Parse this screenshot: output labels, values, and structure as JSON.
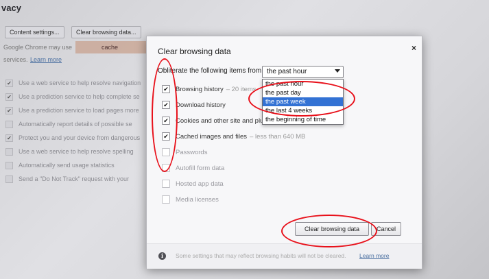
{
  "background_page": {
    "title": "vacy",
    "content_settings_label": "Content settings...",
    "clear_browsing_data_label": "Clear browsing data...",
    "intro_text": "Google Chrome may use",
    "highlight_text": "cache",
    "services_text": "services.",
    "learn_more_label": "Learn more",
    "options": [
      {
        "label": "Use a web service to help resolve navigation",
        "checked": true
      },
      {
        "label": "Use a prediction service to help complete se",
        "checked": true
      },
      {
        "label": "Use a prediction service to load pages more",
        "checked": true
      },
      {
        "label": "Automatically report details of possible se",
        "checked": false
      },
      {
        "label": "Protect you and your device from dangerous",
        "checked": true
      },
      {
        "label": "Use a web service to help resolve spelling",
        "checked": false
      },
      {
        "label": "Automatically send usage statistics",
        "checked": false
      },
      {
        "label": "Send a \"Do Not Track\" request with your",
        "checked": false
      }
    ]
  },
  "dialog": {
    "title": "Clear browsing data",
    "close_symbol": "×",
    "obliterate_label": "Obliterate the following items from:",
    "time_range": {
      "selected": "the past hour",
      "options": [
        "the past hour",
        "the past day",
        "the past week",
        "the last 4 weeks",
        "the beginning of time"
      ],
      "highlighted": "the past week"
    },
    "items": [
      {
        "label": "Browsing history",
        "detail": "– 20 items",
        "checked": true
      },
      {
        "label": "Download history",
        "detail": "",
        "checked": true
      },
      {
        "label": "Cookies and other site and plu",
        "detail": "",
        "checked": true
      },
      {
        "label": "Cached images and files",
        "detail": "– less than 640 MB",
        "checked": true
      },
      {
        "label": "Passwords",
        "detail": "",
        "checked": false
      },
      {
        "label": "Autofill form data",
        "detail": "",
        "checked": false
      },
      {
        "label": "Hosted app data",
        "detail": "",
        "checked": false
      },
      {
        "label": "Media licenses",
        "detail": "",
        "checked": false
      }
    ],
    "primary_button": "Clear browsing data",
    "cancel_button": "Cancel",
    "footer_text": "Some settings that may reflect browsing habits will not be cleared.",
    "footer_link": "Learn more"
  },
  "colors": {
    "annotation": "#e8101a",
    "selection": "#3372d4",
    "link": "#4a6fa0"
  },
  "icons": {
    "info": "info-icon",
    "close": "close-icon",
    "dropdown": "chevron-down-icon",
    "check": "checkmark-icon"
  }
}
